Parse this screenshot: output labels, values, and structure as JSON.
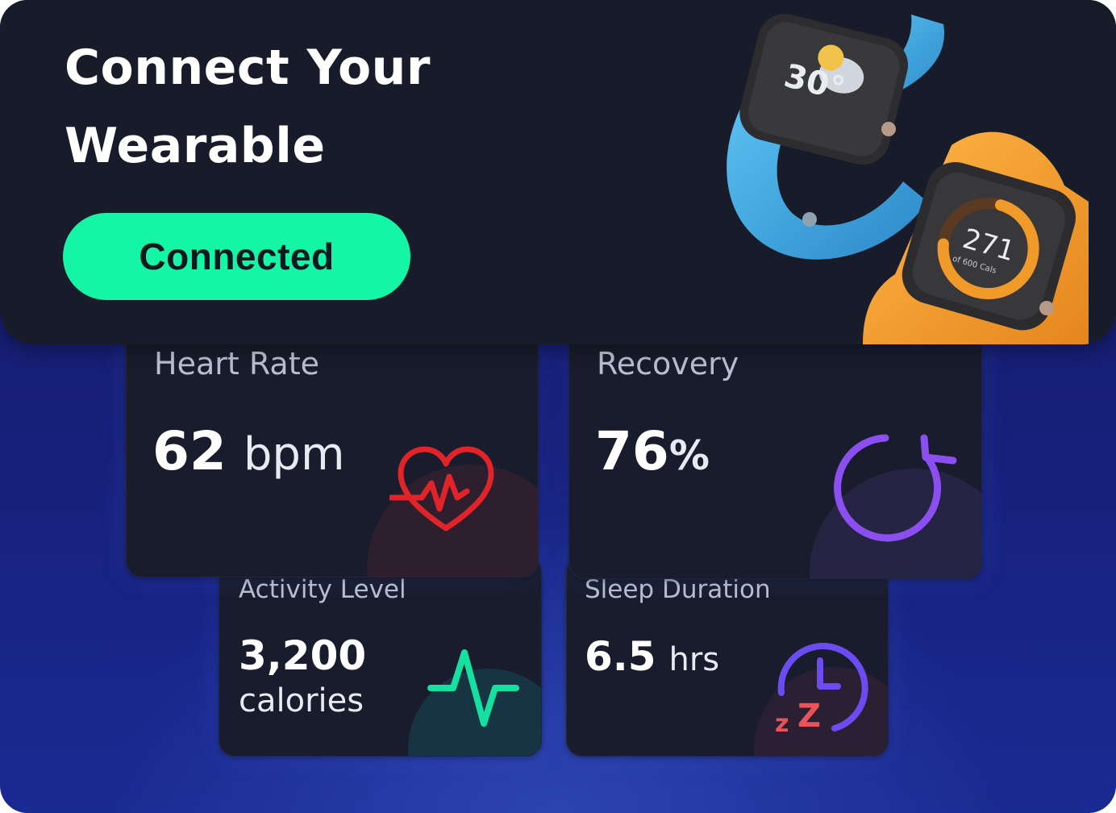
{
  "banner": {
    "title": "Connect Your Wearable",
    "button_label": "Connected",
    "accent_color": "#14f5a5",
    "image": {
      "watch_blue": {
        "temperature_text": "30°",
        "icon": "cloud-sun-icon",
        "band_color": "#3aa6e0"
      },
      "watch_orange": {
        "calories_value": "271",
        "calories_goal_text": "of 600 Cals",
        "icon": "calorie-ring-icon",
        "band_color": "#f09a2a"
      }
    }
  },
  "metrics": {
    "heart_rate": {
      "label": "Heart Rate",
      "value": "62",
      "unit": "bpm",
      "icon": "heartbeat-icon",
      "color": "#e0242a"
    },
    "recovery": {
      "label": "Recovery",
      "value": "76",
      "unit": "%",
      "icon": "refresh-icon",
      "color": "#8b4ff0"
    },
    "activity": {
      "label": "Activity Level",
      "value": "3,200",
      "unit": "calories",
      "icon": "pulse-icon",
      "color": "#14e0a0"
    },
    "sleep": {
      "label": "Sleep Duration",
      "value": "6.5",
      "unit": "hrs",
      "icon": "sleep-clock-icon",
      "color": "#6a4cf0",
      "zz_color": "#e8545a"
    }
  }
}
